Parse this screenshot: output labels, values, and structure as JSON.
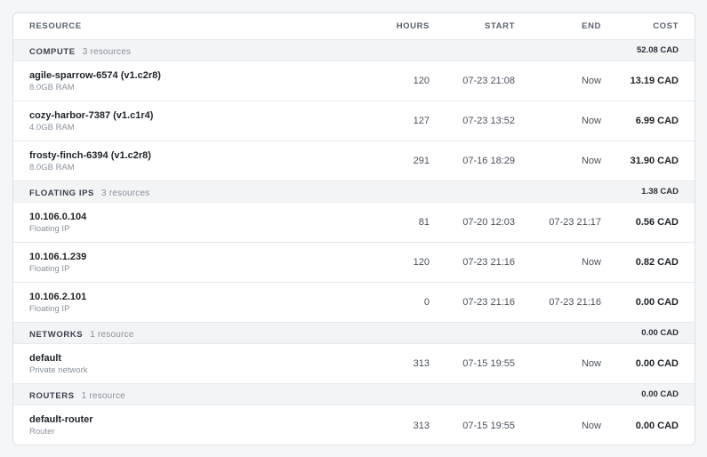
{
  "columns": {
    "resource": "RESOURCE",
    "hours": "HOURS",
    "start": "START",
    "end": "END",
    "cost": "COST"
  },
  "groups": [
    {
      "title": "COMPUTE",
      "count": "3 resources",
      "total": "52.08 CAD",
      "items": [
        {
          "name": "agile-sparrow-6574 (v1.c2r8)",
          "sub": "8.0GB RAM",
          "hours": "120",
          "start": "07-23 21:08",
          "end": "Now",
          "cost": "13.19 CAD"
        },
        {
          "name": "cozy-harbor-7387 (v1.c1r4)",
          "sub": "4.0GB RAM",
          "hours": "127",
          "start": "07-23 13:52",
          "end": "Now",
          "cost": "6.99 CAD"
        },
        {
          "name": "frosty-finch-6394 (v1.c2r8)",
          "sub": "8.0GB RAM",
          "hours": "291",
          "start": "07-16 18:29",
          "end": "Now",
          "cost": "31.90 CAD"
        }
      ]
    },
    {
      "title": "FLOATING IPS",
      "count": "3 resources",
      "total": "1.38 CAD",
      "items": [
        {
          "name": "10.106.0.104",
          "sub": "Floating IP",
          "hours": "81",
          "start": "07-20 12:03",
          "end": "07-23 21:17",
          "cost": "0.56 CAD"
        },
        {
          "name": "10.106.1.239",
          "sub": "Floating IP",
          "hours": "120",
          "start": "07-23 21:16",
          "end": "Now",
          "cost": "0.82 CAD"
        },
        {
          "name": "10.106.2.101",
          "sub": "Floating IP",
          "hours": "0",
          "start": "07-23 21:16",
          "end": "07-23 21:16",
          "cost": "0.00 CAD"
        }
      ]
    },
    {
      "title": "NETWORKS",
      "count": "1 resource",
      "total": "0.00 CAD",
      "items": [
        {
          "name": "default",
          "sub": "Private network",
          "hours": "313",
          "start": "07-15 19:55",
          "end": "Now",
          "cost": "0.00 CAD"
        }
      ]
    },
    {
      "title": "ROUTERS",
      "count": "1 resource",
      "total": "0.00 CAD",
      "items": [
        {
          "name": "default-router",
          "sub": "Router",
          "hours": "313",
          "start": "07-15 19:55",
          "end": "Now",
          "cost": "0.00 CAD"
        }
      ]
    }
  ]
}
